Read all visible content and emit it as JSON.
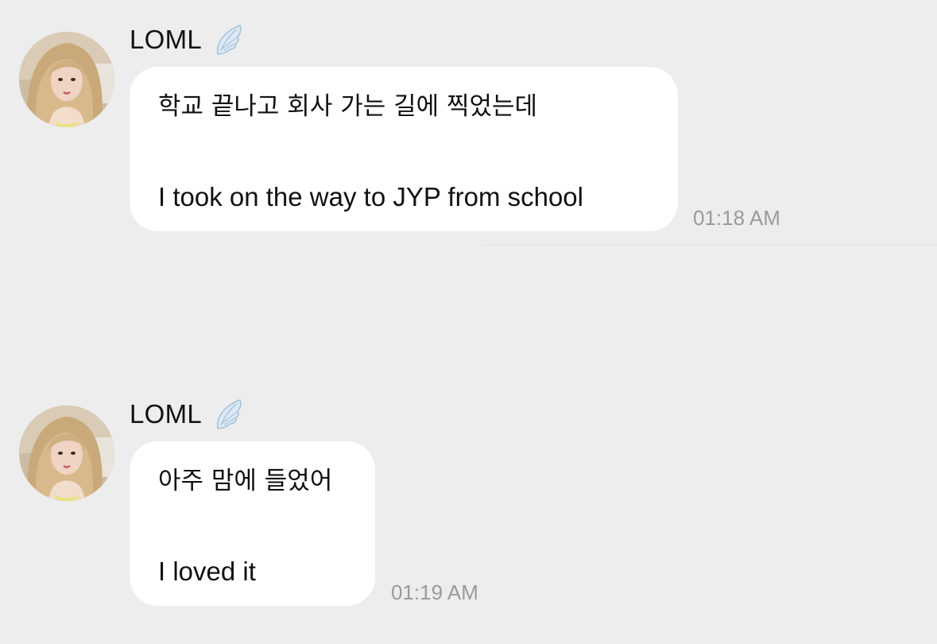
{
  "messages": [
    {
      "sender": "LOML",
      "avatar_icon": "profile-photo",
      "badge_icon": "angel-wing-icon",
      "text_ko": "학교 끝나고 회사 가는 길에 찍었는데",
      "text_en": "I took on the way to JYP from school",
      "time": "01:18 AM"
    },
    {
      "sender": "LOML",
      "avatar_icon": "profile-photo",
      "badge_icon": "angel-wing-icon",
      "text_ko": "아주 맘에 들었어",
      "text_en": "I loved it",
      "time": "01:19 AM"
    }
  ],
  "colors": {
    "background": "#ededed",
    "bubble": "#ffffff",
    "text": "#111111",
    "timestamp": "#9a9a9a",
    "wing": "#c9dcec"
  }
}
